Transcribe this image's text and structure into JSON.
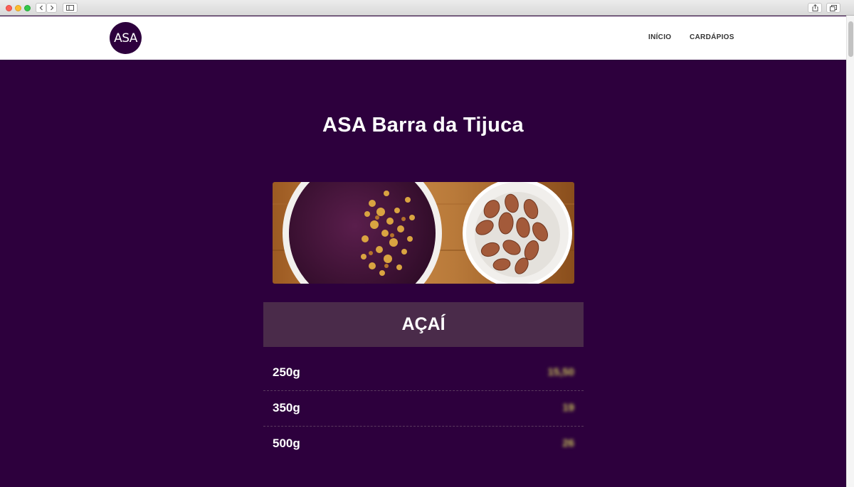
{
  "header": {
    "logo_text": "ASA",
    "nav": [
      {
        "label": "INÍCIO"
      },
      {
        "label": "CARDÁPIOS"
      }
    ]
  },
  "main": {
    "title": "ASA Barra da Tijuca",
    "section": {
      "title": "AÇAÍ",
      "items": [
        {
          "name": "250g",
          "price": "15,50"
        },
        {
          "name": "350g",
          "price": "19"
        },
        {
          "name": "500g",
          "price": "26"
        }
      ]
    }
  },
  "colors": {
    "background": "#2d003d",
    "section_header": "#4a2b4a",
    "price": "#c8c25a"
  }
}
